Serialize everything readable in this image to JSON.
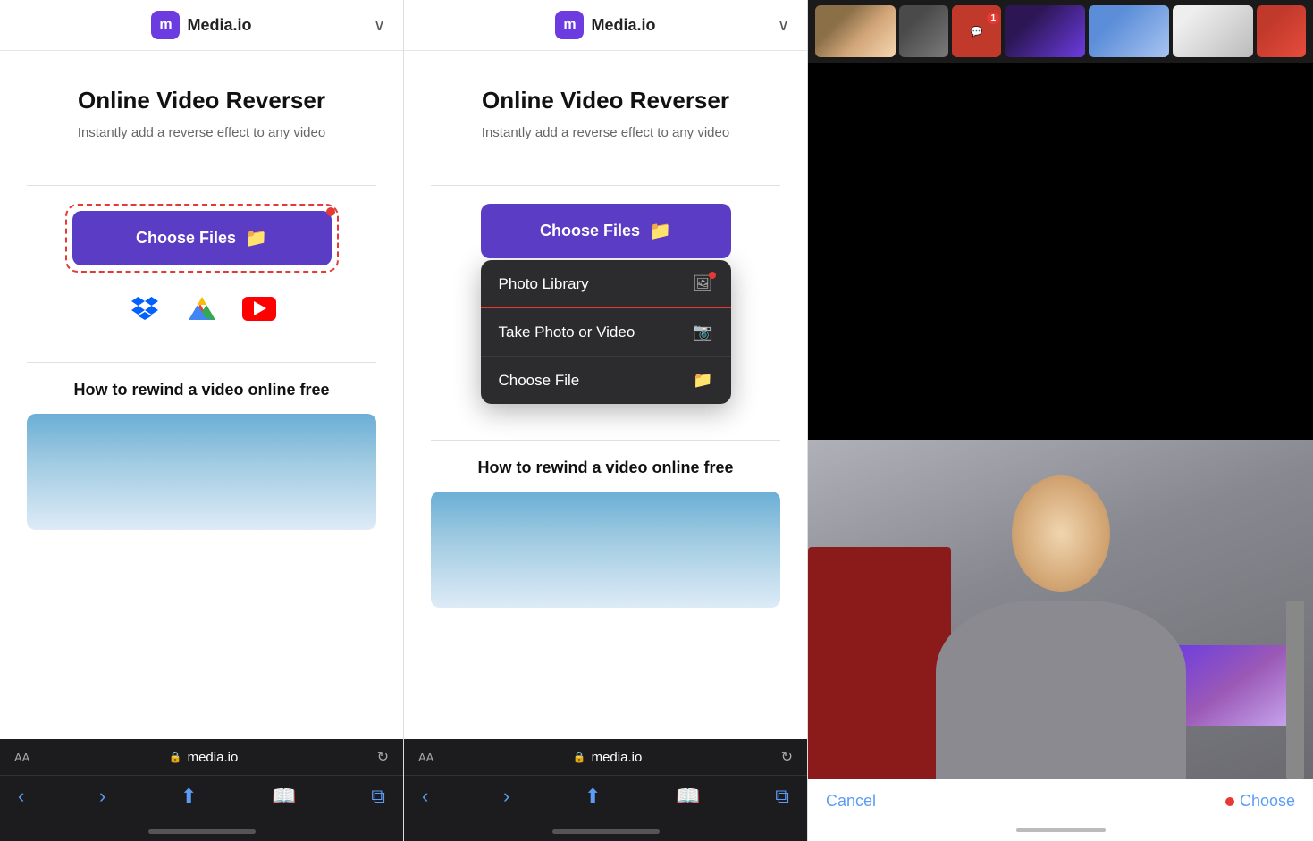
{
  "panel1": {
    "header": {
      "logo_letter": "m",
      "brand_name": "Media.io",
      "chevron": "∨"
    },
    "page_title": "Online Video Reverser",
    "page_subtitle": "Instantly add a reverse effect to any video",
    "choose_files_label": "Choose Files",
    "how_to_title": "How to rewind a video online free",
    "url": "media.io",
    "aa_label": "AA",
    "lock_symbol": "🔒"
  },
  "panel2": {
    "header": {
      "logo_letter": "m",
      "brand_name": "Media.io",
      "chevron": "∨"
    },
    "page_title": "Online Video Reverser",
    "page_subtitle": "Instantly add a reverse effect to any video",
    "choose_files_label": "Choose Files",
    "how_to_title": "How to rewind a video online free",
    "url": "media.io",
    "aa_label": "AA",
    "dropdown": {
      "items": [
        {
          "label": "Photo Library",
          "icon": "🖼"
        },
        {
          "label": "Take Photo or Video",
          "icon": "📷"
        },
        {
          "label": "Choose File",
          "icon": "📁"
        }
      ]
    }
  },
  "panel3": {
    "cancel_label": "Cancel",
    "choose_label": "Choose"
  }
}
